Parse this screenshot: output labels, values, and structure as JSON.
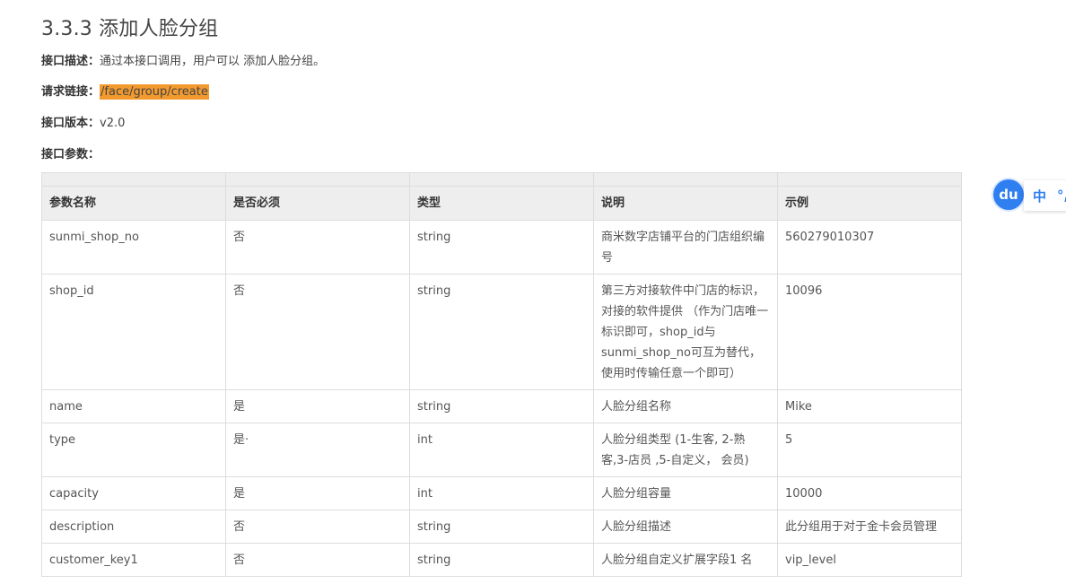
{
  "heading": "3.3.3 添加人脸分组",
  "meta": {
    "desc_key": "接口描述：",
    "desc_value": "通过本接口调用，用户可以 添加人脸分组。",
    "url_key": "请求链接：",
    "url_value": "/face/group/create",
    "version_key": "接口版本：",
    "version_value": "v2.0",
    "params_key": "接口参数："
  },
  "table": {
    "headers": [
      "参数名称",
      "是否必须",
      "类型",
      "说明",
      "示例"
    ],
    "rows": [
      [
        "sunmi_shop_no",
        "否",
        "string",
        "商米数字店铺平台的门店组织编号",
        "560279010307"
      ],
      [
        "shop_id",
        "否",
        "string",
        "第三方对接软件中门店的标识，对接的软件提供 （作为门店唯一标识即可，shop_id与sunmi_shop_no可互为替代，使用时传输任意一个即可）",
        "10096"
      ],
      [
        "name",
        "是",
        "string",
        "人脸分组名称",
        "Mike"
      ],
      [
        "type",
        "是·",
        "int",
        "人脸分组类型 (1-生客, 2-熟客,3-店员 ,5-自定义， 会员)",
        "5"
      ],
      [
        "capacity",
        "是",
        "int",
        "人脸分组容量",
        "10000"
      ],
      [
        "description",
        "否",
        "string",
        "人脸分组描述",
        "此分组用于对于金卡会员管理"
      ],
      [
        "customer_key1",
        "否",
        "string",
        "人脸分组自定义扩展字段1 名",
        "vip_level"
      ]
    ]
  },
  "ime": {
    "badge_text": "du",
    "mode_label": "中",
    "punct_label": "°,"
  }
}
